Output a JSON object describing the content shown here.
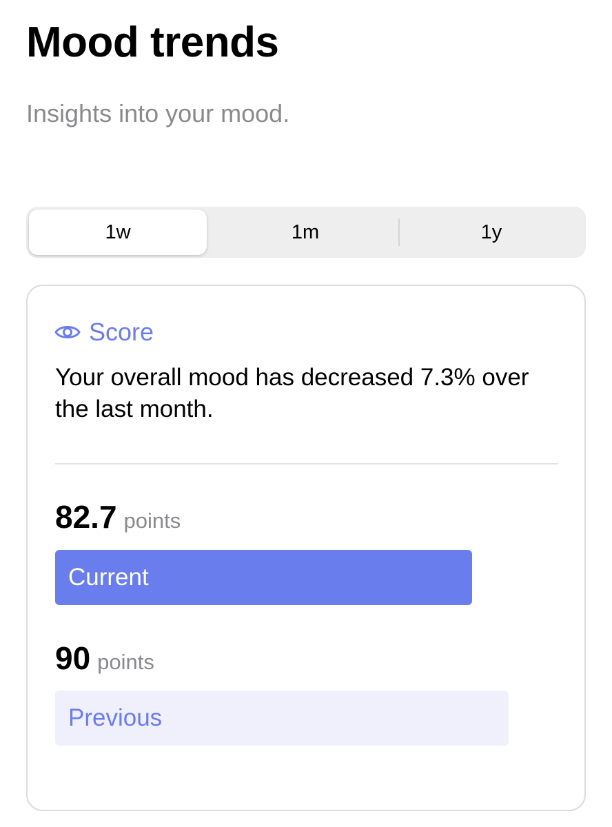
{
  "header": {
    "title": "Mood trends",
    "subtitle": "Insights into your mood."
  },
  "range_selector": {
    "options": [
      {
        "label": "1w",
        "selected": true
      },
      {
        "label": "1m",
        "selected": false
      },
      {
        "label": "1y",
        "selected": false
      }
    ]
  },
  "score_card": {
    "icon": "eye-icon",
    "heading": "Score",
    "summary": "Your overall mood has decreased 7.3% over the last month.",
    "current": {
      "value": "82.7",
      "unit": "points",
      "label": "Current"
    },
    "previous": {
      "value": "90",
      "unit": "points",
      "label": "Previous"
    }
  },
  "colors": {
    "accent": "#6a7ded",
    "accent_light": "#f0f0fd",
    "secondary_text": "#8a8a8e",
    "segment_bg": "#eeeeef"
  }
}
